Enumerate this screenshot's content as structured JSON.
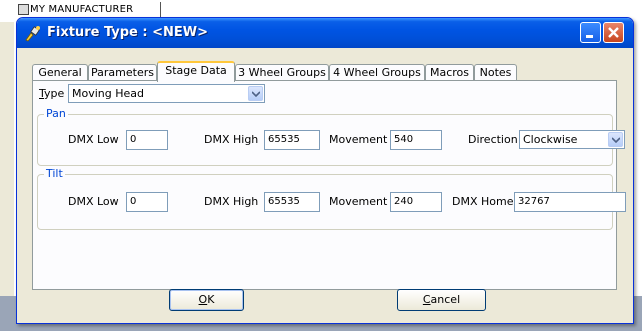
{
  "background": {
    "window_label": "MY MANUFACTURER"
  },
  "dialog": {
    "title": "Fixture Type : <NEW>"
  },
  "tabs": [
    {
      "label": "General"
    },
    {
      "label": "Parameters"
    },
    {
      "label": "Stage Data",
      "active": true
    },
    {
      "label": "3 Wheel Groups"
    },
    {
      "label": "4 Wheel Groups"
    },
    {
      "label": "Macros"
    },
    {
      "label": "Notes"
    }
  ],
  "type": {
    "label_first": "T",
    "label_rest": "ype",
    "value": "Moving Head"
  },
  "pan": {
    "title": "Pan",
    "dmx_low_label": "DMX Low",
    "dmx_low": "0",
    "dmx_high_label": "DMX High",
    "dmx_high": "65535",
    "movement_label": "Movement",
    "movement": "540",
    "direction_label": "Direction",
    "direction": "Clockwise"
  },
  "tilt": {
    "title": "Tilt",
    "dmx_low_label": "DMX Low",
    "dmx_low": "0",
    "dmx_high_label": "DMX High",
    "dmx_high": "65535",
    "movement_label": "Movement",
    "movement": "240",
    "dmx_home_label": "DMX Home",
    "dmx_home": "32767"
  },
  "buttons": {
    "ok_first": "O",
    "ok_rest": "K",
    "cancel_first": "C",
    "cancel_rest": "ancel"
  },
  "colors": {
    "titlebar": "#0054e3",
    "group_title": "#0046d5",
    "active_tab_accent": "#ffc83c"
  }
}
